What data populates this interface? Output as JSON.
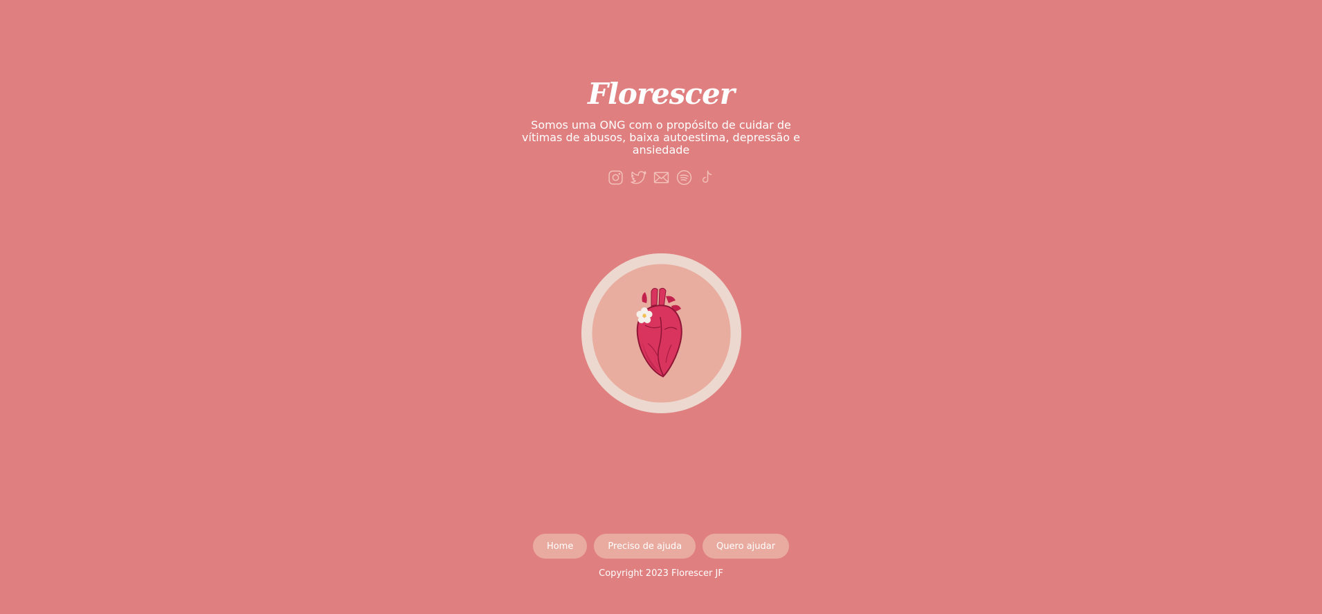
{
  "brand": {
    "name": "Florescer",
    "tagline": "Somos uma ONG com o propósito de cuidar de vítimas de abusos, baixa autoestima, depressão e ansiedade"
  },
  "socials": [
    {
      "icon": "instagram-icon"
    },
    {
      "icon": "twitter-icon"
    },
    {
      "icon": "mail-icon"
    },
    {
      "icon": "spotify-icon"
    },
    {
      "icon": "tiktok-icon"
    }
  ],
  "emblem": {
    "icon": "anatomical-heart-with-flower"
  },
  "nav": {
    "home": "Home",
    "need_help": "Preciso de ajuda",
    "want_to_help": "Quero ajudar"
  },
  "footer": {
    "copyright": "Copyright 2023 Florescer JF"
  },
  "colors": {
    "background": "#e07f7f",
    "button": "#e9ab9f",
    "emblem_ring": "#ecd8cf",
    "emblem_inner": "#e8ad9f",
    "heart": "#d8345e",
    "icon": "#f3c2bb"
  }
}
